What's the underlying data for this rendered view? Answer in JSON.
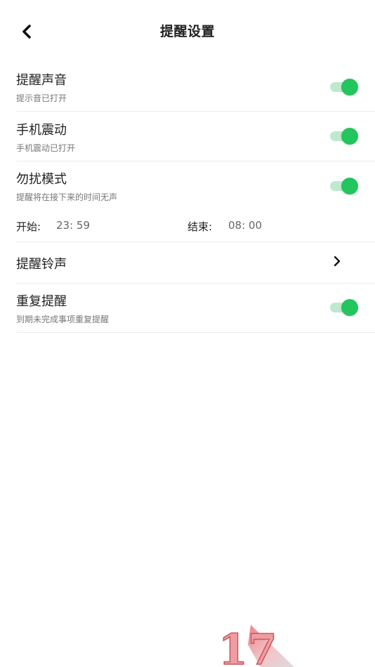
{
  "header": {
    "title": "提醒设置"
  },
  "settings": {
    "sound": {
      "title": "提醒声音",
      "subtitle": "提示音已打开",
      "enabled": true
    },
    "vibrate": {
      "title": "手机震动",
      "subtitle": "手机震动已打开",
      "enabled": true
    },
    "dnd": {
      "title": "勿扰模式",
      "subtitle": "提醒将在接下来的时间无声",
      "enabled": true,
      "start_label": "开始:",
      "start_time": "23: 59",
      "end_label": "结束:",
      "end_time": "08: 00"
    },
    "ringtone": {
      "title": "提醒铃声"
    },
    "repeat": {
      "title": "重复提醒",
      "subtitle": "到期未完成事项重复提醒",
      "enabled": true
    }
  },
  "colors": {
    "toggle_on": "#22c55e",
    "toggle_track": "#bfe9cd",
    "divider": "#eeeeee"
  },
  "icons": {
    "back": "chevron-left-icon",
    "ringtone_arrow": "chevron-right-icon",
    "watermark": "logo-17"
  }
}
